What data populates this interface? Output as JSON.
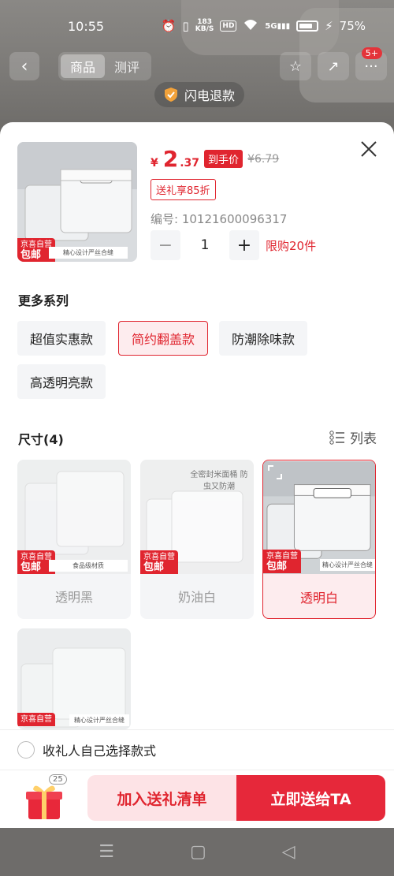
{
  "status_bar": {
    "time": "10:55",
    "net_speed_top": "183",
    "net_speed_unit": "KB/S",
    "hd": "HD",
    "signal": "5G",
    "battery": "75%"
  },
  "nav": {
    "tabs": [
      {
        "label": "商品"
      },
      {
        "label": "测评"
      }
    ],
    "cart_badge": "5+"
  },
  "refund_pill": {
    "label": "闪电退款"
  },
  "product": {
    "currency": "¥",
    "price_int": "2",
    "price_dec": ".37",
    "price_tag": "到手价",
    "orig_price": "¥6.79",
    "discount": "送礼享85折",
    "sku": "编号: 10121600096317",
    "quantity": "1",
    "limit": "限购20件",
    "thumb_badge_top": "京喜自营",
    "thumb_badge_bottom": "包邮",
    "thumb_banner": "精心设计严丝合缝"
  },
  "series": {
    "title": "更多系列",
    "options": [
      {
        "label": "超值实惠款",
        "selected": false
      },
      {
        "label": "简约翻盖款",
        "selected": true
      },
      {
        "label": "防潮除味款",
        "selected": false
      },
      {
        "label": "高透明亮款",
        "selected": false
      }
    ]
  },
  "sizes": {
    "title": "尺寸(4)",
    "list_toggle": "列表",
    "items": [
      {
        "label": "透明黑",
        "selected": false,
        "img_text": "食品级材质",
        "badge_top": "京喜自营",
        "badge_bottom": "包邮"
      },
      {
        "label": "奶油白",
        "selected": false,
        "img_text": "全密封米面桶 防虫又防潮",
        "badge_top": "京喜自营",
        "badge_bottom": "包邮"
      },
      {
        "label": "透明白",
        "selected": true,
        "img_text": "精心设计严丝合缝",
        "badge_top": "京喜自营",
        "badge_bottom": "包邮"
      },
      {
        "label": "",
        "selected": false,
        "img_text": "精心设计严丝合缝",
        "badge_top": "京喜自营",
        "badge_bottom": ""
      }
    ]
  },
  "gift_choice": {
    "label": "收礼人自己选择款式"
  },
  "actions": {
    "gift_count": "25",
    "add_label": "加入送礼清单",
    "send_label": "立即送给TA"
  },
  "colors": {
    "accent": "#e0252f",
    "chip_bg": "#f4f5f7"
  }
}
